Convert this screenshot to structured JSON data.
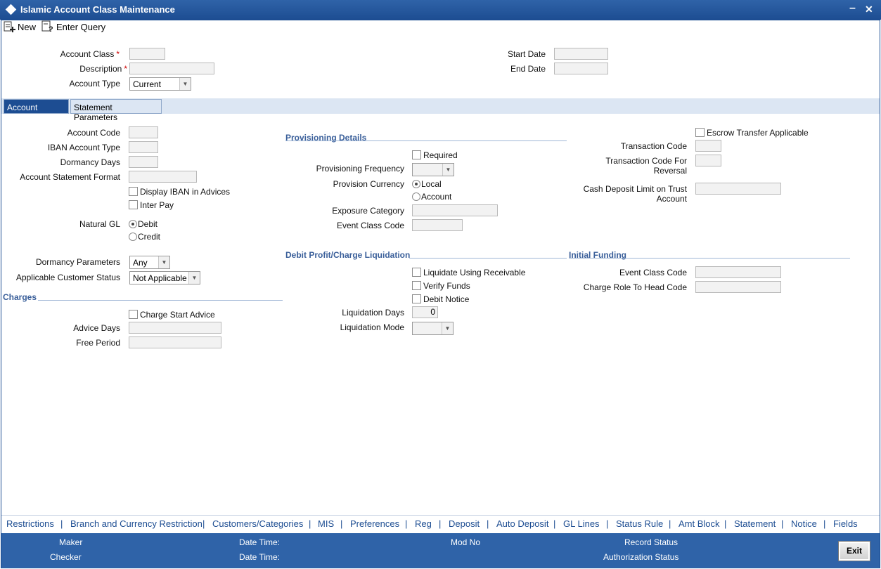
{
  "window": {
    "title": "Islamic Account Class Maintenance",
    "minimize": "–",
    "close": "✕"
  },
  "toolbar": {
    "new_label": "New",
    "enter_query_label": "Enter Query"
  },
  "header": {
    "account_class_label": "Account Class",
    "description_label": "Description",
    "account_type_label": "Account Type",
    "account_type_value": "Current",
    "start_date_label": "Start Date",
    "end_date_label": "End Date",
    "required_mark": "*"
  },
  "tabs": [
    {
      "label": "Account Details",
      "active": true
    },
    {
      "label": "Statement Parameters",
      "active": false
    }
  ],
  "left": {
    "account_code": "Account Code",
    "iban_account_type": "IBAN Account Type",
    "dormancy_days": "Dormancy Days",
    "account_statement_format": "Account Statement Format",
    "display_iban": "Display IBAN in Advices",
    "inter_pay": "Inter Pay",
    "natural_gl": "Natural GL",
    "debit": "Debit",
    "credit": "Credit",
    "dormancy_parameters": "Dormancy Parameters",
    "dormancy_parameters_value": "Any",
    "applicable_customer_status": "Applicable Customer Status",
    "applicable_customer_status_value": "Not Applicable",
    "charges_section": "Charges",
    "charge_start_advice": "Charge Start Advice",
    "advice_days": "Advice Days",
    "free_period": "Free Period"
  },
  "middle": {
    "provisioning_section": "Provisioning Details",
    "required": "Required",
    "provisioning_frequency": "Provisioning Frequency",
    "provision_currency": "Provision Currency",
    "local": "Local",
    "account": "Account",
    "exposure_category": "Exposure Category",
    "event_class_code": "Event Class Code",
    "debit_profit_section": "Debit Profit/Charge Liquidation",
    "liquidate_using_receivable": "Liquidate Using Receivable",
    "verify_funds": "Verify Funds",
    "debit_notice": "Debit Notice",
    "liquidation_days": "Liquidation Days",
    "liquidation_days_value": "0",
    "liquidation_mode": "Liquidation Mode"
  },
  "right": {
    "escrow_transfer": "Escrow Transfer Applicable",
    "transaction_code": "Transaction Code",
    "transaction_code_reversal_1": "Transaction Code For",
    "transaction_code_reversal_2": "Reversal",
    "cash_deposit_limit_1": "Cash Deposit Limit on Trust",
    "cash_deposit_limit_2": "Account",
    "initial_funding_section": "Initial Funding",
    "event_class_code": "Event Class Code",
    "charge_role_to_head_code": "Charge Role To Head Code"
  },
  "bottom_nav": [
    "Restrictions",
    "Branch and Currency Restriction",
    "Customers/Categories",
    "MIS",
    "Preferences",
    "Reg",
    "Deposit",
    "Auto Deposit",
    "GL Lines",
    "Status Rule",
    "Amt Block",
    "Statement",
    "Notice",
    "Fields"
  ],
  "bottom_nav_separator": "|",
  "status": {
    "maker": "Maker",
    "checker": "Checker",
    "date_time_1": "Date Time:",
    "date_time_2": "Date Time:",
    "mod_no": "Mod No",
    "record_status": "Record Status",
    "authorization_status": "Authorization Status",
    "exit": "Exit"
  },
  "colors": {
    "title_bar": "#1d4d92",
    "accent": "#2f63a8",
    "section": "#3a5f9a"
  }
}
